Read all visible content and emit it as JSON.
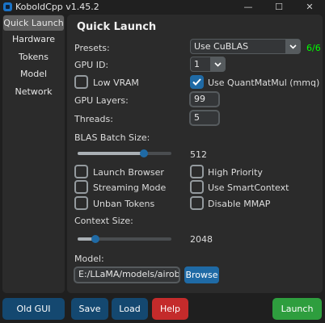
{
  "window": {
    "title": "KoboldCpp v1.45.2",
    "minimize": "—",
    "maximize": "☐",
    "close": "✕"
  },
  "sidebar": {
    "items": [
      {
        "label": "Quick Launch",
        "active": true
      },
      {
        "label": "Hardware"
      },
      {
        "label": "Tokens"
      },
      {
        "label": "Model"
      },
      {
        "label": "Network"
      }
    ]
  },
  "main": {
    "heading": "Quick Launch",
    "presets": {
      "label": "Presets:",
      "value": "Use CuBLAS",
      "count": "6/6"
    },
    "gpu_id": {
      "label": "GPU ID:",
      "value": "1"
    },
    "low_vram": {
      "label": "Low VRAM",
      "checked": false
    },
    "quantmatmul": {
      "label": "Use QuantMatMul (mmq)",
      "checked": true
    },
    "gpu_layers": {
      "label": "GPU Layers:",
      "value": "99"
    },
    "threads": {
      "label": "Threads:",
      "value": "5"
    },
    "blas_batch": {
      "label": "BLAS Batch Size:",
      "value": "512",
      "fraction": 0.71
    },
    "launch_browser": {
      "label": "Launch Browser",
      "checked": false
    },
    "high_priority": {
      "label": "High Priority",
      "checked": false
    },
    "streaming_mode": {
      "label": "Streaming Mode",
      "checked": false
    },
    "smartcontext": {
      "label": "Use SmartContext",
      "checked": false
    },
    "unban_tokens": {
      "label": "Unban Tokens",
      "checked": false
    },
    "disable_mmap": {
      "label": "Disable MMAP",
      "checked": false
    },
    "context_size": {
      "label": "Context Size:",
      "value": "2048",
      "fraction": 0.19
    },
    "model": {
      "label": "Model:",
      "value": "E:/LLaMA/models/airoboro",
      "browse": "Browse"
    }
  },
  "footer": {
    "old_gui": "Old GUI",
    "save": "Save",
    "load": "Load",
    "help": "Help",
    "launch": "Launch"
  },
  "colors": {
    "accent": "#1f6aa5",
    "count": "#00ff00",
    "help": "#c42b2b",
    "launch": "#2e9e3e",
    "footer_btn": "#144870"
  }
}
